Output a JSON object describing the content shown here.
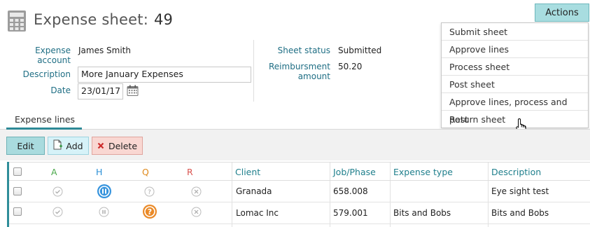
{
  "header": {
    "title": "Expense sheet:",
    "number": "49"
  },
  "actions": {
    "label": "Actions",
    "menu": [
      "Submit sheet",
      "Approve lines",
      "Process sheet",
      "Post sheet",
      "Approve lines, process and post",
      "Return sheet"
    ]
  },
  "form": {
    "expense_account_label_1": "Expense",
    "expense_account_label_2": "account",
    "expense_account_value": "James Smith",
    "description_label": "Description",
    "description_value": "More January Expenses",
    "date_label": "Date",
    "date_value": "23/01/17",
    "sheet_status_label": "Sheet status",
    "sheet_status_value": "Submitted",
    "reimbursment_label_1": "Reimbursment",
    "reimbursment_label_2": "amount",
    "reimbursment_value": "50.20"
  },
  "tabs": {
    "active": "Expense lines"
  },
  "toolbar": {
    "edit": "Edit",
    "add": "Add",
    "delete": "Delete"
  },
  "table": {
    "columns": [
      "A",
      "H",
      "Q",
      "R",
      "Client",
      "Job/Phase",
      "Expense type",
      "Description"
    ],
    "column_colors": {
      "A": "#4aa84a",
      "H": "#2b8fd6",
      "Q": "#e08a1c",
      "R": "#d9534f",
      "text": "#1f7f8c"
    },
    "rows": [
      {
        "client": "Granada",
        "job": "658.008",
        "expense_type": "",
        "description": "Eye sight test",
        "icons": [
          "check-circle",
          "pause-circle-active",
          "question-circle",
          "x-circle"
        ]
      },
      {
        "client": "Lomac Inc",
        "job": "579.001",
        "expense_type": "Bits and Bobs",
        "description": "Bits and Bobs",
        "icons": [
          "check-circle",
          "pause-circle",
          "question-circle-active",
          "x-circle"
        ]
      }
    ]
  }
}
